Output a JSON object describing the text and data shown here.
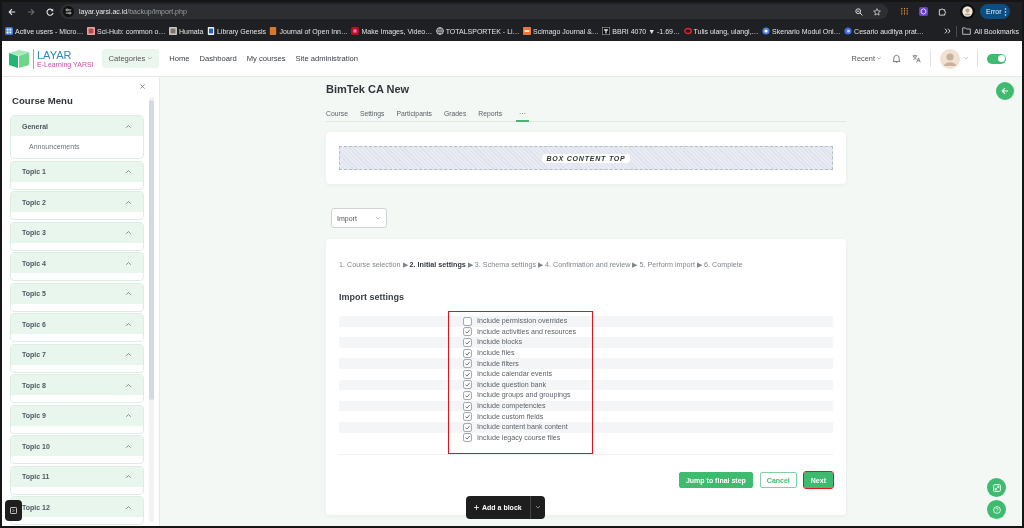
{
  "browser": {
    "url_host": "layar.yarsi.ac.id",
    "url_path": "/backup/import.php",
    "profile_button": "Error",
    "bookmarks": [
      {
        "label": "Active users - Micro…"
      },
      {
        "label": "Sci-Hub: common o…"
      },
      {
        "label": "Humata"
      },
      {
        "label": "Library Genesis"
      },
      {
        "label": "Journal of Open Inn…"
      },
      {
        "label": "Make Images, Video…"
      },
      {
        "label": "TOTALSPORTEK - Li…"
      },
      {
        "label": "Scimago Journal &…"
      },
      {
        "label": "BBRI 4070 ▼ -1.69…"
      },
      {
        "label": "Tulis ulang, ulangi,…"
      },
      {
        "label": "Skenario Modul Onl…"
      },
      {
        "label": "Cesario auditya prat…"
      }
    ],
    "all_bookmarks": "All Bookmarks"
  },
  "navbar": {
    "logo_title": "LAYAR",
    "logo_subtitle": "E-Learning YARSI",
    "menu": [
      {
        "label": "Categories",
        "kind": "dropdown"
      },
      {
        "label": "Home",
        "kind": "link"
      },
      {
        "label": "Dashboard",
        "kind": "link"
      },
      {
        "label": "My courses",
        "kind": "link"
      },
      {
        "label": "Site administration",
        "kind": "link"
      }
    ],
    "recent": "Recent",
    "edit_mode": true
  },
  "course_menu": {
    "title": "Course Menu",
    "sections": [
      {
        "title": "General",
        "expanded": true,
        "children": [
          {
            "label": "Announcements"
          }
        ]
      },
      {
        "title": "Topic 1",
        "expanded": true
      },
      {
        "title": "Topic 2",
        "expanded": true
      },
      {
        "title": "Topic 3",
        "expanded": true
      },
      {
        "title": "Topic 4",
        "expanded": true
      },
      {
        "title": "Topic 5",
        "expanded": true
      },
      {
        "title": "Topic 6",
        "expanded": true
      },
      {
        "title": "Topic 7",
        "expanded": true
      },
      {
        "title": "Topic 8",
        "expanded": true
      },
      {
        "title": "Topic 9",
        "expanded": true
      },
      {
        "title": "Topic 10",
        "expanded": true
      },
      {
        "title": "Topic 11",
        "expanded": true
      },
      {
        "title": "Topic 12",
        "expanded": true
      }
    ]
  },
  "course": {
    "title": "BimTek CA New",
    "tabs": [
      {
        "label": "Course",
        "selected": false
      },
      {
        "label": "Settings",
        "selected": false
      },
      {
        "label": "Participants",
        "selected": false
      },
      {
        "label": "Grades",
        "selected": false
      },
      {
        "label": "Reports",
        "selected": false
      },
      {
        "label": "···",
        "selected": true
      }
    ],
    "box_label": "BOX CONTENT TOP"
  },
  "action_select": {
    "value": "Import"
  },
  "import": {
    "steps": "1. Course selection ▶ **2. Initial settings** ▶ 3. Schema settings ▶ 4. Confirmation and review ▶ 5. Perform import ▶ 6. Complete",
    "heading": "Import settings",
    "highlighted": true,
    "settings": [
      {
        "label": "Include permission overrides",
        "checked": false
      },
      {
        "label": "Include activities and resources",
        "checked": true
      },
      {
        "label": "Include blocks",
        "checked": true
      },
      {
        "label": "Include files",
        "checked": true
      },
      {
        "label": "Include filters",
        "checked": true
      },
      {
        "label": "Include calendar events",
        "checked": true
      },
      {
        "label": "Include question bank",
        "checked": true
      },
      {
        "label": "Include groups and groupings",
        "checked": true
      },
      {
        "label": "Include competencies",
        "checked": true
      },
      {
        "label": "Include custom fields",
        "checked": true
      },
      {
        "label": "Include content bank content",
        "checked": true
      },
      {
        "label": "Include legacy course files",
        "checked": true
      }
    ]
  },
  "buttons": [
    {
      "label": "Jump to final step",
      "kind": "primary",
      "highlighted": false
    },
    {
      "label": "Cancel",
      "kind": "secondary",
      "highlighted": false
    },
    {
      "label": "Next",
      "kind": "primary",
      "highlighted": true
    }
  ],
  "add_block": {
    "label": "Add a block"
  }
}
